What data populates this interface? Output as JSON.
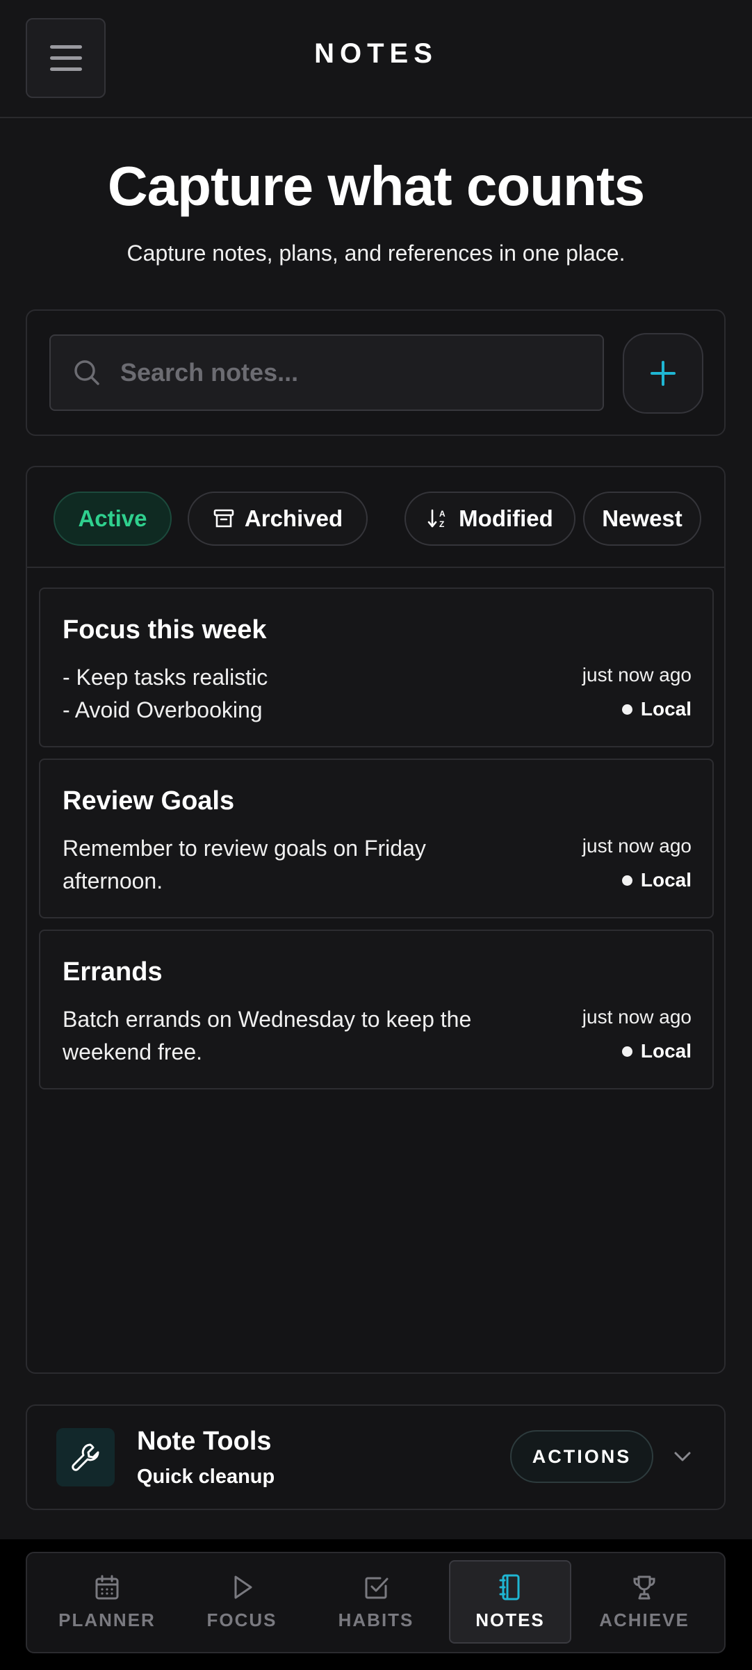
{
  "header": {
    "title": "NOTES",
    "menu_icon": "hamburger-icon"
  },
  "hero": {
    "title": "Capture what counts",
    "subtitle": "Capture notes, plans, and references in one place."
  },
  "search": {
    "placeholder": "Search notes...",
    "add_icon": "plus-icon"
  },
  "filters": {
    "active": "Active",
    "archived": "Archived",
    "sort_field": "Modified",
    "sort_order": "Newest"
  },
  "notes": [
    {
      "title": "Focus this week",
      "body": "- Keep tasks realistic\n- Avoid Overbooking",
      "time": "just now ago",
      "status": "Local"
    },
    {
      "title": "Review Goals",
      "body": "Remember to review goals on Friday afternoon.",
      "time": "just now ago",
      "status": "Local"
    },
    {
      "title": "Errands",
      "body": "Batch errands on Wednesday to keep the weekend free.",
      "time": "just now ago",
      "status": "Local"
    }
  ],
  "tools": {
    "title": "Note Tools",
    "subtitle": "Quick cleanup",
    "actions_label": "ACTIONS"
  },
  "nav": {
    "items": [
      {
        "label": "PLANNER",
        "icon": "calendar-icon"
      },
      {
        "label": "FOCUS",
        "icon": "play-icon"
      },
      {
        "label": "HABITS",
        "icon": "checkbox-icon"
      },
      {
        "label": "NOTES",
        "icon": "notebook-icon"
      },
      {
        "label": "ACHIEVE",
        "icon": "trophy-icon"
      }
    ],
    "active_index": 3
  },
  "colors": {
    "accent_cyan": "#1fb6d3",
    "active_green": "#2fd08e",
    "background": "#151517"
  }
}
